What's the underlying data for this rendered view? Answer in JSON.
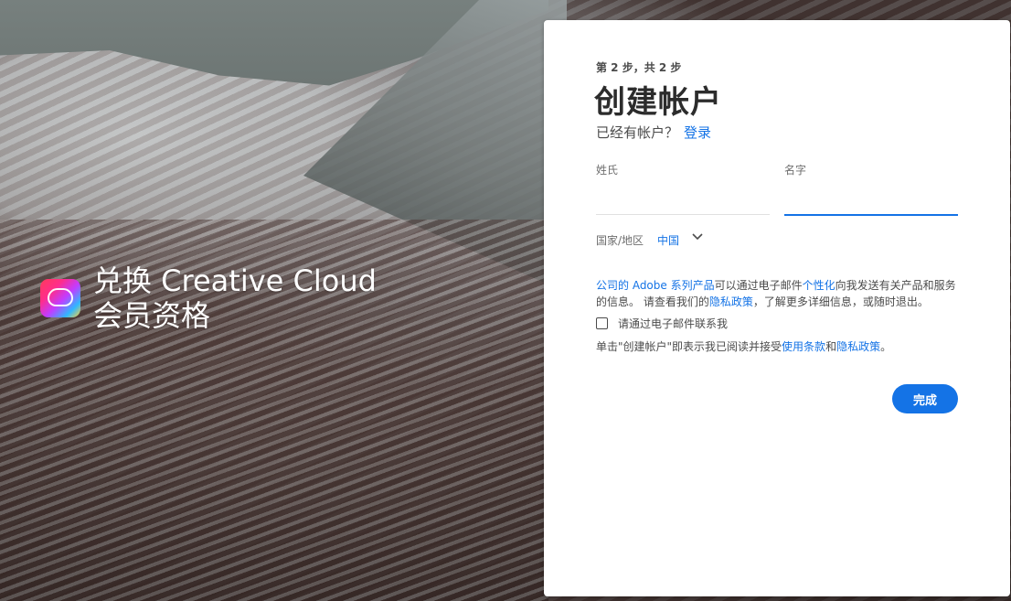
{
  "hero": {
    "title": "兑换 Creative Cloud 会员资格",
    "logo_icon": "creative-cloud-logo"
  },
  "form": {
    "step": "第 2 步，共 2 步",
    "title": "创建帐户",
    "have_account_text": "已经有帐户？",
    "login_link": "登录",
    "last_name_label": "姓氏",
    "last_name_value": "",
    "first_name_label": "名字",
    "first_name_value": "",
    "country_label": "国家/地区",
    "country_value": "中国",
    "consent": {
      "link_company": "公司的 Adobe 系列产品",
      "text1": "可以通过电子邮件",
      "link_personalize": "个性化",
      "text2": "向我发送有关产品和服务的信息。 请查看我们的",
      "link_privacy": "隐私政策",
      "text3": "，了解更多详细信息，或随时退出。"
    },
    "email_checkbox_label": "请通过电子邮件联系我",
    "email_checkbox_checked": false,
    "terms": {
      "text1": "单击\"创建帐户\"即表示我已阅读并接受",
      "link_terms": "使用条款",
      "text2": "和",
      "link_privacy": "隐私政策",
      "text3": "。"
    },
    "done_button": "完成"
  },
  "colors": {
    "accent": "#1473e6",
    "text": "#4b4b4b",
    "title": "#2c2c2c"
  }
}
